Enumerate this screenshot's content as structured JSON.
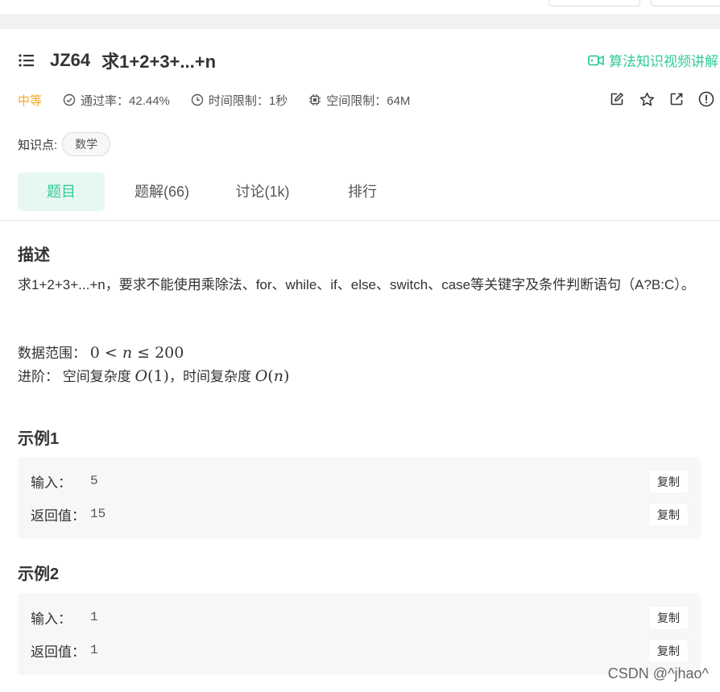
{
  "problem": {
    "id": "JZ64",
    "title": "求1+2+3+...+n",
    "video_link": "算法知识视频讲解",
    "difficulty": "中等",
    "pass_rate": "通过率：42.44%",
    "time_limit": "时间限制：1秒",
    "space_limit": "空间限制：64M",
    "knowledge_label": "知识点:",
    "knowledge_tags": [
      "数学"
    ]
  },
  "tabs": [
    "题目",
    "题解(66)",
    "讨论(1k)",
    "排行"
  ],
  "description": {
    "heading": "描述",
    "text": "求1+2+3+...+n，要求不能使用乘除法、for、while、if、else、switch、case等关键字及条件判断语句（A?B:C）。",
    "range_label": "数据范围：",
    "advanced_label": "进阶：",
    "space_complexity_label": "空间复杂度",
    "time_complexity_label": "，时间复杂度"
  },
  "examples": [
    {
      "heading": "示例1",
      "input_label": "输入：",
      "input_value": "5",
      "return_label": "返回值：",
      "return_value": "15",
      "copy_label": "复制"
    },
    {
      "heading": "示例2",
      "input_label": "输入：",
      "input_value": "1",
      "return_label": "返回值：",
      "return_value": "1",
      "copy_label": "复制"
    }
  ],
  "watermark": "CSDN @^jhao^",
  "colors": {
    "accent": "#32ca99",
    "difficulty": "#f5a623"
  }
}
